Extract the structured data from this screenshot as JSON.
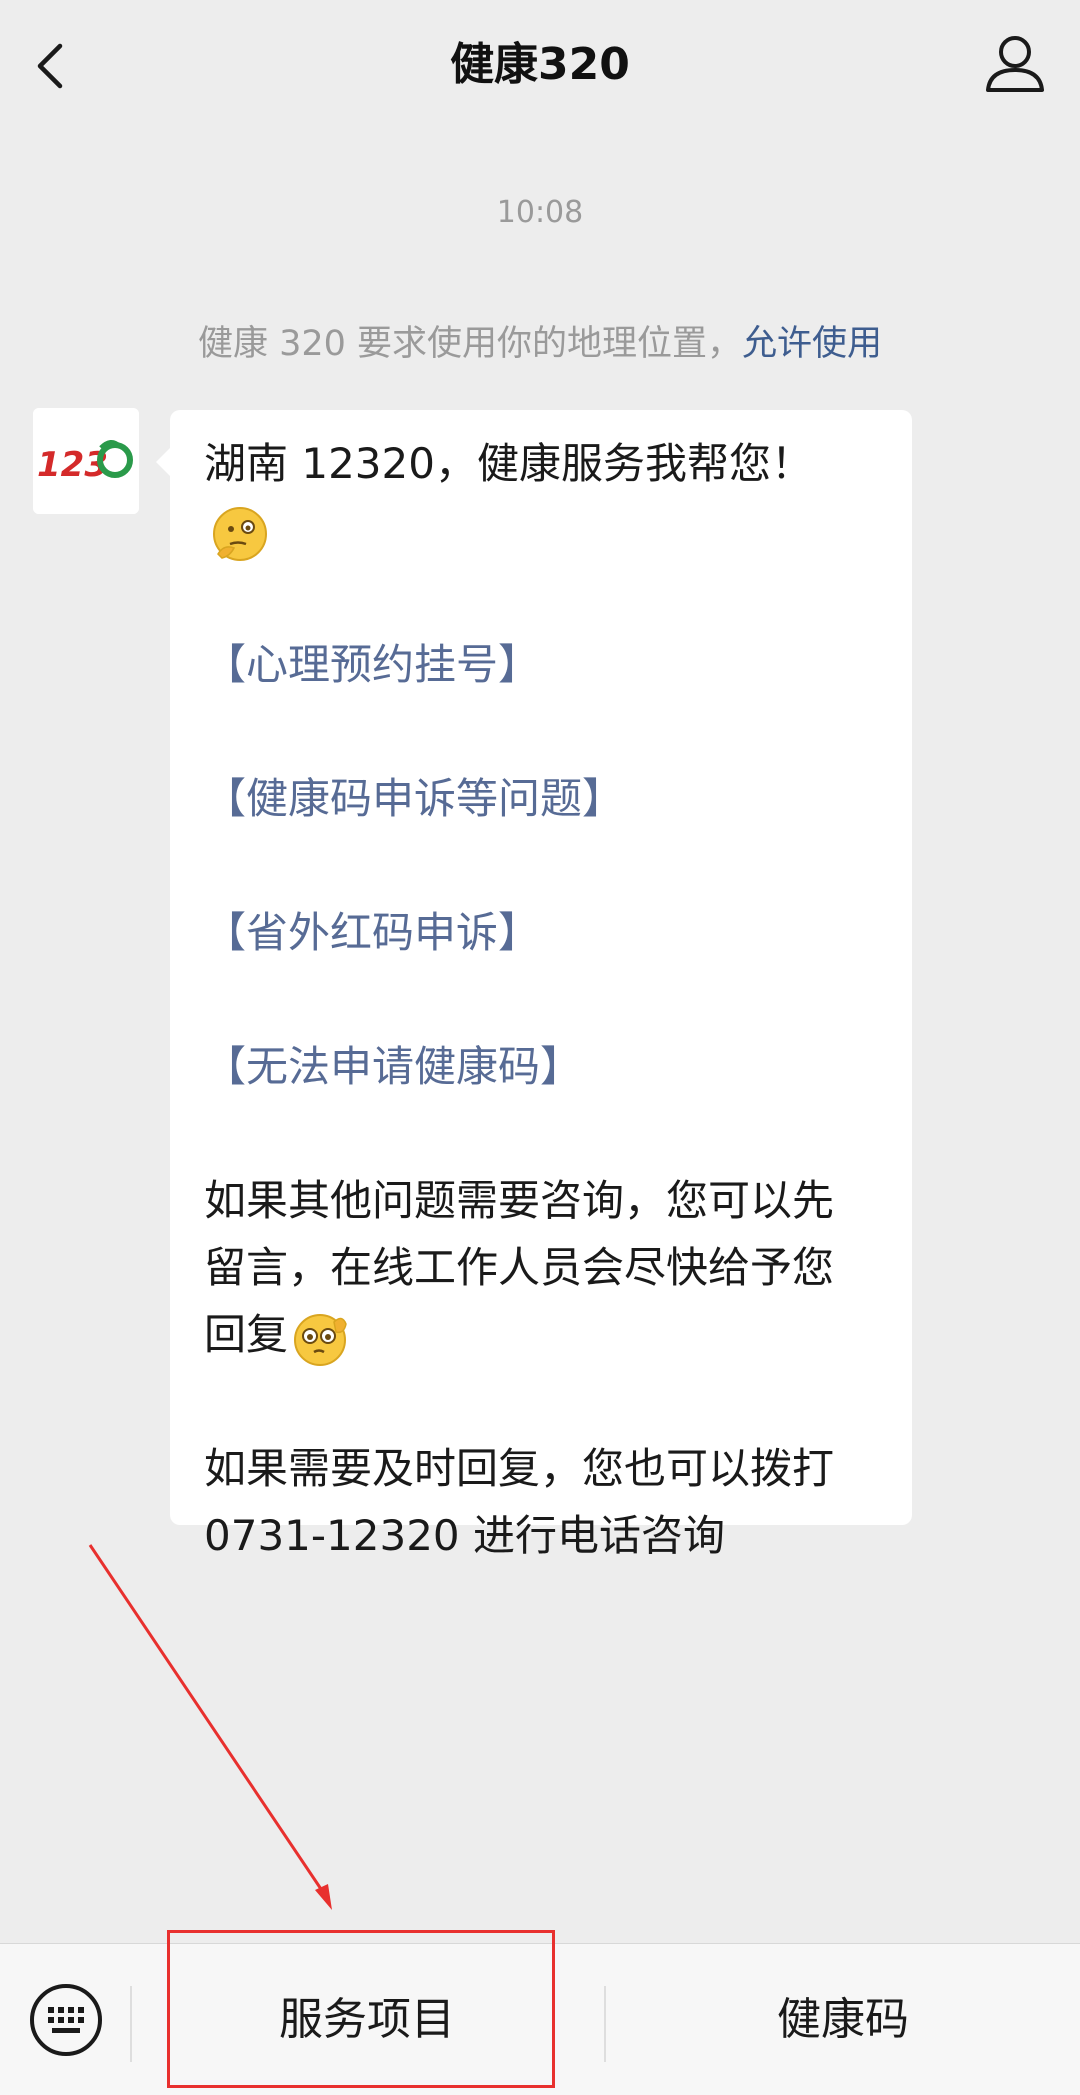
{
  "header": {
    "title": "健康320",
    "back_icon": "chevron-left-icon",
    "profile_icon": "user-icon"
  },
  "chat": {
    "timestamp": "10:08",
    "location_notice": {
      "text": "健康 320 要求使用你的地理位置，",
      "action": "允许使用"
    },
    "avatar_label": "12320",
    "message": {
      "greeting": "湖南 12320，健康服务我帮您！",
      "links": [
        "【心理预约挂号】",
        "【健康码申诉等问题】",
        "【省外红码申诉】",
        "【无法申请健康码】"
      ],
      "para1_line1": "如果其他问题需要咨询，您可以先",
      "para1_line2": "留言，在线工作人员会尽快给予您",
      "para1_line3": "回复",
      "para2_line1": "如果需要及时回复，您也可以拨打",
      "para2_line2": "0731-12320 进行电话咨询"
    }
  },
  "bottom_menu": {
    "keyboard_icon": "keyboard-icon",
    "items": [
      {
        "label": "服务项目"
      },
      {
        "label": "健康码"
      }
    ]
  },
  "colors": {
    "background": "#ededed",
    "link": "#576b95",
    "allow_link": "#3e5d8f",
    "annotation_red": "#e8302e"
  }
}
